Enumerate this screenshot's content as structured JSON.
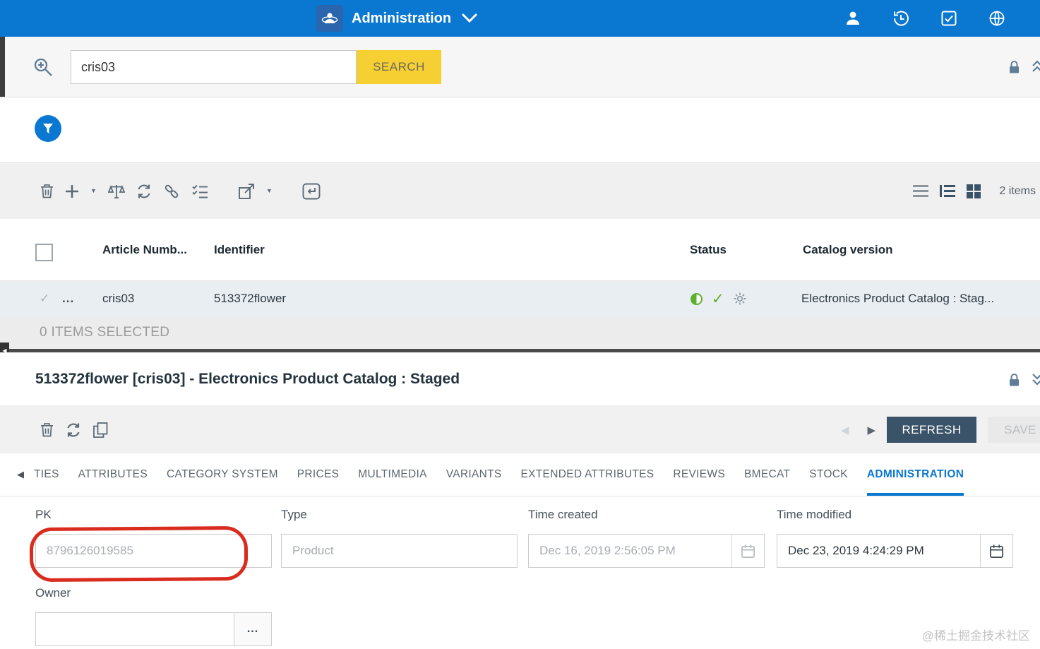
{
  "colors": {
    "accent_blue": "#0a78d1",
    "search_yellow": "#f6cf33",
    "refresh_dark": "#3b5368",
    "status_green": "#5eb02c",
    "annotation_red": "#d92b1e"
  },
  "icons": {
    "caret_down": "▼",
    "check": "✓",
    "prev": "◀",
    "next": "▶",
    "splitter_collapse": "◀",
    "tab_scroll_left": "◀"
  },
  "topbar": {
    "title": "Administration"
  },
  "search": {
    "value": "cris03",
    "button_label": "SEARCH"
  },
  "list": {
    "items_count": "2 items",
    "headers": {
      "article": "Article Numb...",
      "identifier": "Identifier",
      "status": "Status",
      "catalog": "Catalog version"
    },
    "row": {
      "more": "...",
      "article": "cris03",
      "identifier": "513372flower",
      "catalog": "Electronics Product Catalog : Stag..."
    },
    "selection_text": "0 ITEMS SELECTED"
  },
  "editor": {
    "title": "513372flower [cris03] - Electronics Product Catalog : Staged",
    "refresh_label": "REFRESH",
    "save_label": "SAVE",
    "tabs": [
      "TIES",
      "ATTRIBUTES",
      "CATEGORY SYSTEM",
      "PRICES",
      "MULTIMEDIA",
      "VARIANTS",
      "EXTENDED ATTRIBUTES",
      "REVIEWS",
      "BMECAT",
      "STOCK",
      "ADMINISTRATION"
    ],
    "active_tab": "ADMINISTRATION",
    "fields": {
      "pk_label": "PK",
      "pk_value": "8796126019585",
      "type_label": "Type",
      "type_value": "Product",
      "created_label": "Time created",
      "created_value": "Dec 16, 2019 2:56:05 PM",
      "modified_label": "Time modified",
      "modified_value": "Dec 23, 2019 4:24:29 PM",
      "owner_label": "Owner",
      "owner_value": "",
      "owner_more": "..."
    }
  },
  "watermark": "@稀土掘金技术社区"
}
